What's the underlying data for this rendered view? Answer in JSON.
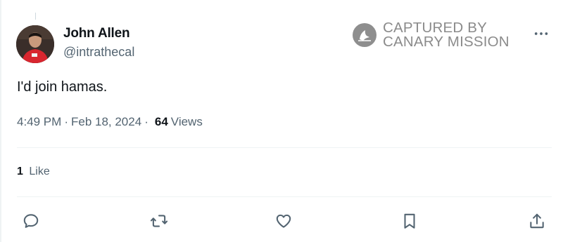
{
  "author": {
    "name": "John Allen",
    "handle": "@intrathecal",
    "avatar_icon": "user-avatar"
  },
  "watermark": {
    "line1": "CAPTURED BY",
    "line2": "CANARY MISSION",
    "logo_icon": "canary-mission-logo",
    "color": "#8b8b8b"
  },
  "tweet": {
    "text": "I'd join hamas.",
    "time": "4:49 PM",
    "separator": "·",
    "date": "Feb 18, 2024",
    "views_count": "64",
    "views_label": "Views"
  },
  "engagement": {
    "likes_count": "1",
    "likes_label": "Like"
  },
  "actions": [
    {
      "name": "reply",
      "icon": "reply-icon"
    },
    {
      "name": "repost",
      "icon": "repost-icon"
    },
    {
      "name": "like",
      "icon": "heart-icon"
    },
    {
      "name": "bookmark",
      "icon": "bookmark-icon"
    },
    {
      "name": "share",
      "icon": "share-icon"
    }
  ],
  "more_icon": "more-options-icon",
  "colors": {
    "text_primary": "#0f1419",
    "text_secondary": "#536471",
    "border": "#eff3f4"
  }
}
